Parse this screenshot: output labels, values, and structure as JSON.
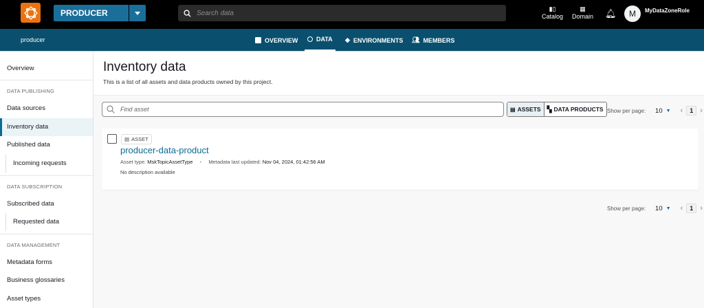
{
  "topbar": {
    "project_selector": "PRODUCER",
    "search_placeholder": "Search data",
    "catalog": "Catalog",
    "domain": "Domain",
    "avatar_initial": "M",
    "role": "MyDataZoneRole"
  },
  "navbar": {
    "project": "producer",
    "tabs": [
      {
        "label": "OVERVIEW",
        "icon": "chart-icon"
      },
      {
        "label": "DATA",
        "icon": "circle-icon",
        "active": true
      },
      {
        "label": "ENVIRONMENTS",
        "icon": "layers-icon"
      },
      {
        "label": "MEMBERS",
        "icon": "users-icon"
      }
    ]
  },
  "sidebar": {
    "overview": "Overview",
    "sections": [
      {
        "header": "DATA PUBLISHING",
        "items": [
          "Data sources",
          "Inventory data",
          "Published data",
          "Incoming requests"
        ]
      },
      {
        "header": "DATA SUBSCRIPTION",
        "items": [
          "Subscribed data",
          "Requested data"
        ]
      },
      {
        "header": "DATA MANAGEMENT",
        "items": [
          "Metadata forms",
          "Business glossaries",
          "Asset types"
        ]
      }
    ],
    "selected": "Inventory data"
  },
  "main": {
    "title": "Inventory data",
    "description": "This is a list of all assets and data products owned by this project.",
    "find_placeholder": "Find asset",
    "toggle": {
      "assets": "ASSETS",
      "data_products": "DATA PRODUCTS"
    },
    "pagination": {
      "label": "Show per page:",
      "per_page": "10",
      "page": "1"
    },
    "items": [
      {
        "badge": "ASSET",
        "name": "producer-data-product",
        "asset_type_label": "Asset type:",
        "asset_type": "MskTopicAssetType",
        "updated_label": "Metadata last updated:",
        "updated": "Nov 04, 2024, 01:42:56 AM",
        "description": "No description available"
      }
    ]
  },
  "colors": {
    "brand": "#ec7211",
    "primary": "#1a6f9a",
    "nav": "#0a4f6e",
    "link": "#0a6b93"
  }
}
